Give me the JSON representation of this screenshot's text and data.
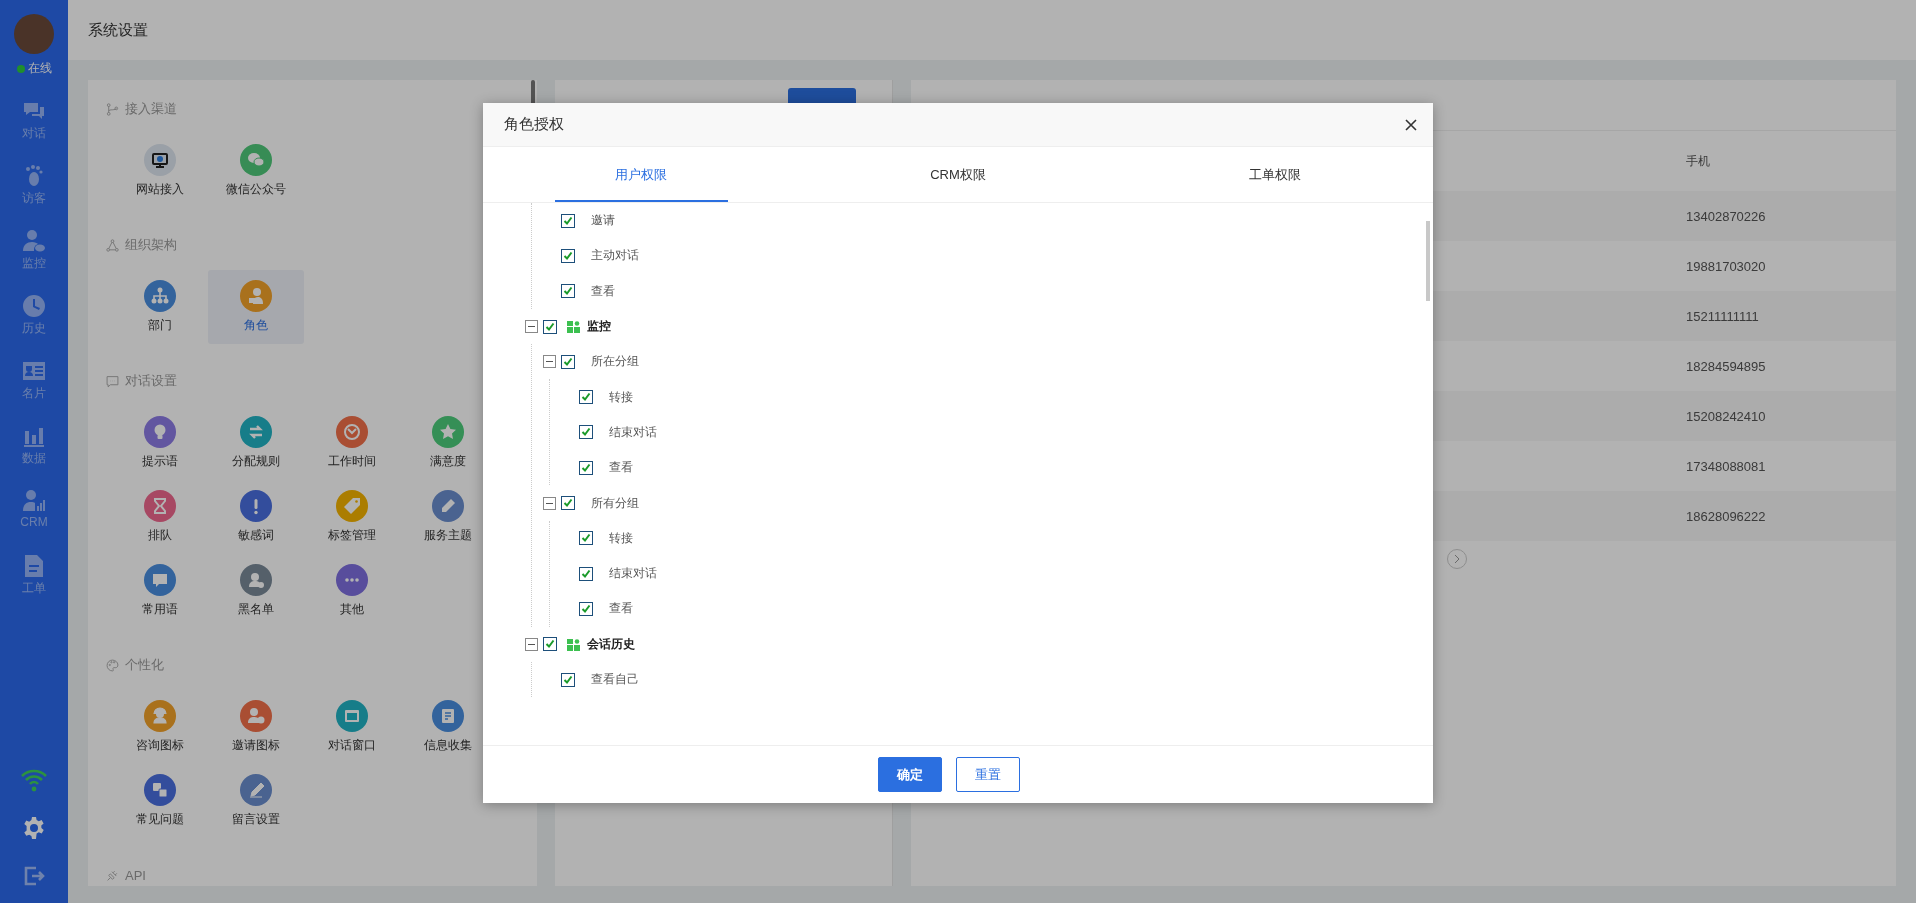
{
  "sidebar": {
    "status": {
      "label": "在线",
      "online": true
    },
    "nav_items": [
      {
        "label": "对话"
      },
      {
        "label": "访客"
      },
      {
        "label": "监控"
      },
      {
        "label": "历史"
      },
      {
        "label": "名片"
      },
      {
        "label": "数据"
      },
      {
        "label": "CRM"
      },
      {
        "label": "工单"
      }
    ]
  },
  "header": {
    "title": "系统设置"
  },
  "settings_panel": {
    "sections": [
      {
        "title": "接入渠道",
        "items": [
          {
            "label": "网站接入",
            "selected": false
          },
          {
            "label": "微信公众号",
            "selected": false
          }
        ]
      },
      {
        "title": "组织架构",
        "items": [
          {
            "label": "部门",
            "selected": false
          },
          {
            "label": "角色",
            "selected": true
          }
        ]
      },
      {
        "title": "对话设置",
        "items": [
          {
            "label": "提示语",
            "selected": false
          },
          {
            "label": "分配规则",
            "selected": false
          },
          {
            "label": "工作时间",
            "selected": false
          },
          {
            "label": "满意度",
            "selected": false
          },
          {
            "label": "排队",
            "selected": false
          },
          {
            "label": "敏感词",
            "selected": false
          },
          {
            "label": "标签管理",
            "selected": false
          },
          {
            "label": "服务主题",
            "selected": false
          },
          {
            "label": "常用语",
            "selected": false
          },
          {
            "label": "黑名单",
            "selected": false
          },
          {
            "label": "其他",
            "selected": false
          }
        ]
      },
      {
        "title": "个性化",
        "items": [
          {
            "label": "咨询图标",
            "selected": false
          },
          {
            "label": "邀请图标",
            "selected": false
          },
          {
            "label": "对话窗口",
            "selected": false
          },
          {
            "label": "信息收集",
            "selected": false
          },
          {
            "label": "常见问题",
            "selected": false
          },
          {
            "label": "留言设置",
            "selected": false
          }
        ]
      },
      {
        "title": "API"
      }
    ]
  },
  "admin_panel": {
    "table": {
      "columns": [
        "手机"
      ],
      "rows": [
        [
          "13402870226"
        ],
        [
          "19881703020"
        ],
        [
          "15211111111"
        ],
        [
          "18284594895"
        ],
        [
          "15208242410"
        ],
        [
          "17348088081"
        ],
        [
          "18628096222"
        ]
      ]
    }
  },
  "dialog": {
    "title": "角色授权",
    "tabs": [
      {
        "label": "用户权限",
        "selected": true
      },
      {
        "label": "CRM权限",
        "selected": false
      },
      {
        "label": "工单权限",
        "selected": false
      }
    ],
    "tree": {
      "continued_children": [
        {
          "label": "邀请",
          "checked": true
        },
        {
          "label": "主动对话",
          "checked": true
        },
        {
          "label": "查看",
          "checked": true
        }
      ],
      "nodes": [
        {
          "label": "监控",
          "checked": true,
          "expanded": true,
          "children": [
            {
              "label": "所在分组",
              "checked": true,
              "expanded": true,
              "children": [
                {
                  "label": "转接",
                  "checked": true
                },
                {
                  "label": "结束对话",
                  "checked": true
                },
                {
                  "label": "查看",
                  "checked": true
                }
              ]
            },
            {
              "label": "所有分组",
              "checked": true,
              "expanded": true,
              "children": [
                {
                  "label": "转接",
                  "checked": true
                },
                {
                  "label": "结束对话",
                  "checked": true
                },
                {
                  "label": "查看",
                  "checked": true
                }
              ]
            }
          ]
        },
        {
          "label": "会话历史",
          "checked": true,
          "expanded": true,
          "children": [
            {
              "label": "查看自己",
              "checked": true
            }
          ]
        }
      ]
    },
    "buttons": [
      {
        "label": "确定",
        "kind": "primary"
      },
      {
        "label": "重置",
        "kind": "outline"
      }
    ]
  }
}
